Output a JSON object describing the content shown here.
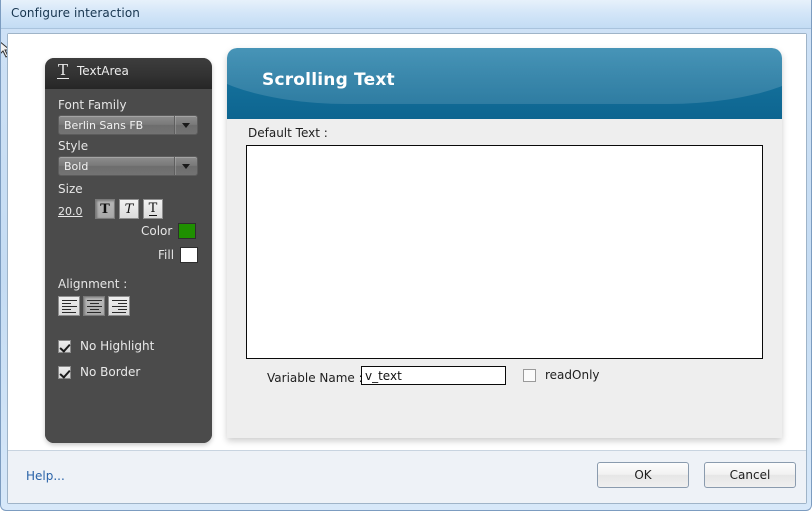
{
  "window": {
    "title": "Configure interaction"
  },
  "sidebar": {
    "tab": {
      "icon": "text-t-icon",
      "label": "TextArea"
    },
    "font_family": {
      "label": "Font Family",
      "value": "Berlin Sans FB",
      "arrow_icon": "chevron-down-icon"
    },
    "style": {
      "label": "Style",
      "value": "Bold",
      "arrow_icon": "chevron-down-icon"
    },
    "size": {
      "label": "Size",
      "value": "20.0"
    },
    "style_buttons": [
      {
        "name": "bold-button",
        "glyph": "T",
        "pressed": true
      },
      {
        "name": "italic-button",
        "glyph": "T",
        "pressed": false
      },
      {
        "name": "underline-button",
        "glyph": "T",
        "pressed": false
      }
    ],
    "color": {
      "label": "Color",
      "value": "#1f9000"
    },
    "fill": {
      "label": "Fill",
      "value": "#ffffff"
    },
    "alignment": {
      "label": "Alignment :",
      "buttons": [
        {
          "name": "align-left-button",
          "pressed": false
        },
        {
          "name": "align-center-button",
          "pressed": true
        },
        {
          "name": "align-right-button",
          "pressed": false
        }
      ]
    },
    "checkboxes": [
      {
        "name": "no-highlight-checkbox",
        "label": "No Highlight",
        "checked": true
      },
      {
        "name": "no-border-checkbox",
        "label": "No Border",
        "checked": true
      }
    ]
  },
  "card": {
    "title": "Scrolling Text",
    "header_color": "#0d6590",
    "default_text": {
      "label": "Default Text :",
      "value": ""
    },
    "variable_name": {
      "label": "Variable Name :",
      "value": "v_text"
    },
    "read_only": {
      "label": "readOnly",
      "checked": false
    }
  },
  "footer": {
    "help_label": "Help...",
    "ok_label": "OK",
    "cancel_label": "Cancel"
  }
}
